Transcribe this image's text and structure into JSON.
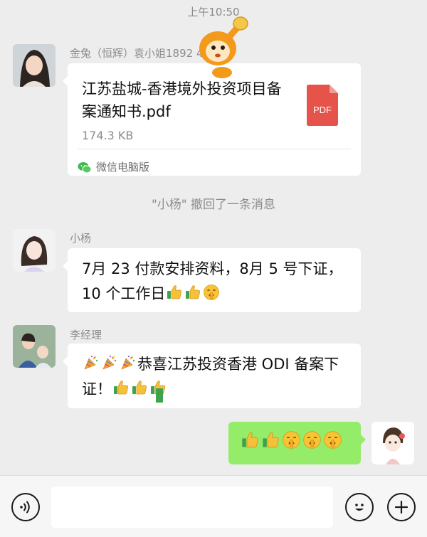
{
  "status": {
    "time": "上午10:50"
  },
  "messages": {
    "m1": {
      "sender": "金兔（恒辉）袁小姐1892  460",
      "file_name": "江苏盐城-香港境外投资项目备案通知书.pdf",
      "file_size": "174.3 KB",
      "file_type": "PDF",
      "source_app": "微信电脑版"
    },
    "system": {
      "text": "\"小杨\" 撤回了一条消息"
    },
    "m2": {
      "sender": "小杨",
      "text": "7月 23 付款安排资料，8月 5 号下证，10 个工作日"
    },
    "m3": {
      "sender": "李经理",
      "text": "恭喜江苏投资香港 ODI 备案下证！"
    }
  },
  "composer": {
    "placeholder": ""
  },
  "icons": {
    "voice": "voice-icon",
    "emoji": "emoji-icon",
    "plus": "plus-icon",
    "thumbs_up": "thumbs-up-emoji",
    "shush": "shushing-face-emoji",
    "party": "party-popper-emoji"
  },
  "colors": {
    "background": "#ededed",
    "bubble_incoming": "#ffffff",
    "bubble_outgoing": "#95ec69",
    "pdf_red": "#e5534b",
    "mascot_orange": "#f39a1c"
  }
}
